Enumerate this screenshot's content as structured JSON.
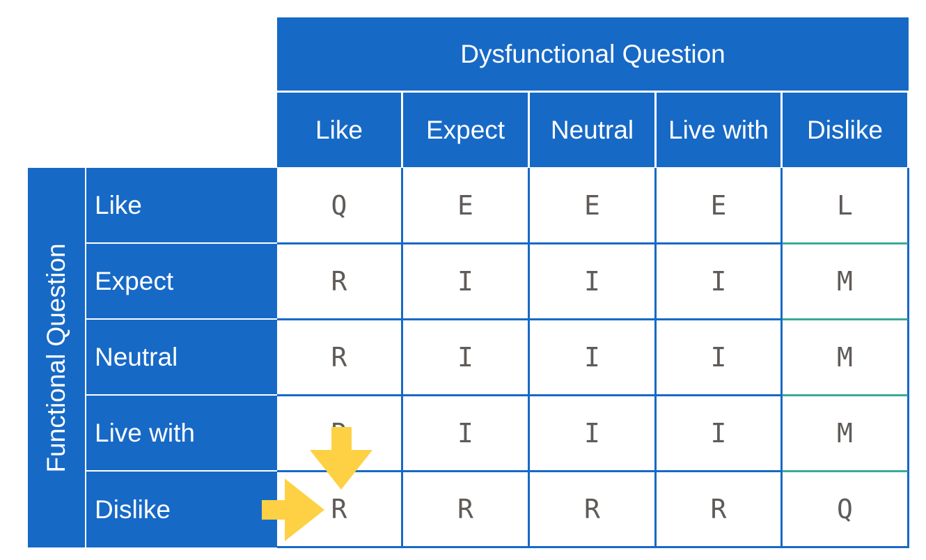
{
  "dysfunctional_title": "Dysfunctional Question",
  "functional_title": "Functional Question",
  "columns": [
    "Like",
    "Expect",
    "Neutral",
    "Live with",
    "Dislike"
  ],
  "rows": [
    {
      "label": "Like",
      "cells": [
        "Q",
        "E",
        "E",
        "E",
        "L"
      ]
    },
    {
      "label": "Expect",
      "cells": [
        "R",
        "I",
        "I",
        "I",
        "M"
      ]
    },
    {
      "label": "Neutral",
      "cells": [
        "R",
        "I",
        "I",
        "I",
        "M"
      ]
    },
    {
      "label": "Live with",
      "cells": [
        "R",
        "I",
        "I",
        "I",
        "M"
      ]
    },
    {
      "label": "Dislike",
      "cells": [
        "R",
        "R",
        "R",
        "R",
        "Q"
      ]
    }
  ],
  "colors": {
    "header_blue": "#1769c6",
    "arrow_yellow": "#fed145",
    "cell_text": "#5f5b58",
    "accent_line": "#3aaa98"
  },
  "icons": [
    "arrow-down-icon",
    "arrow-right-icon"
  ]
}
